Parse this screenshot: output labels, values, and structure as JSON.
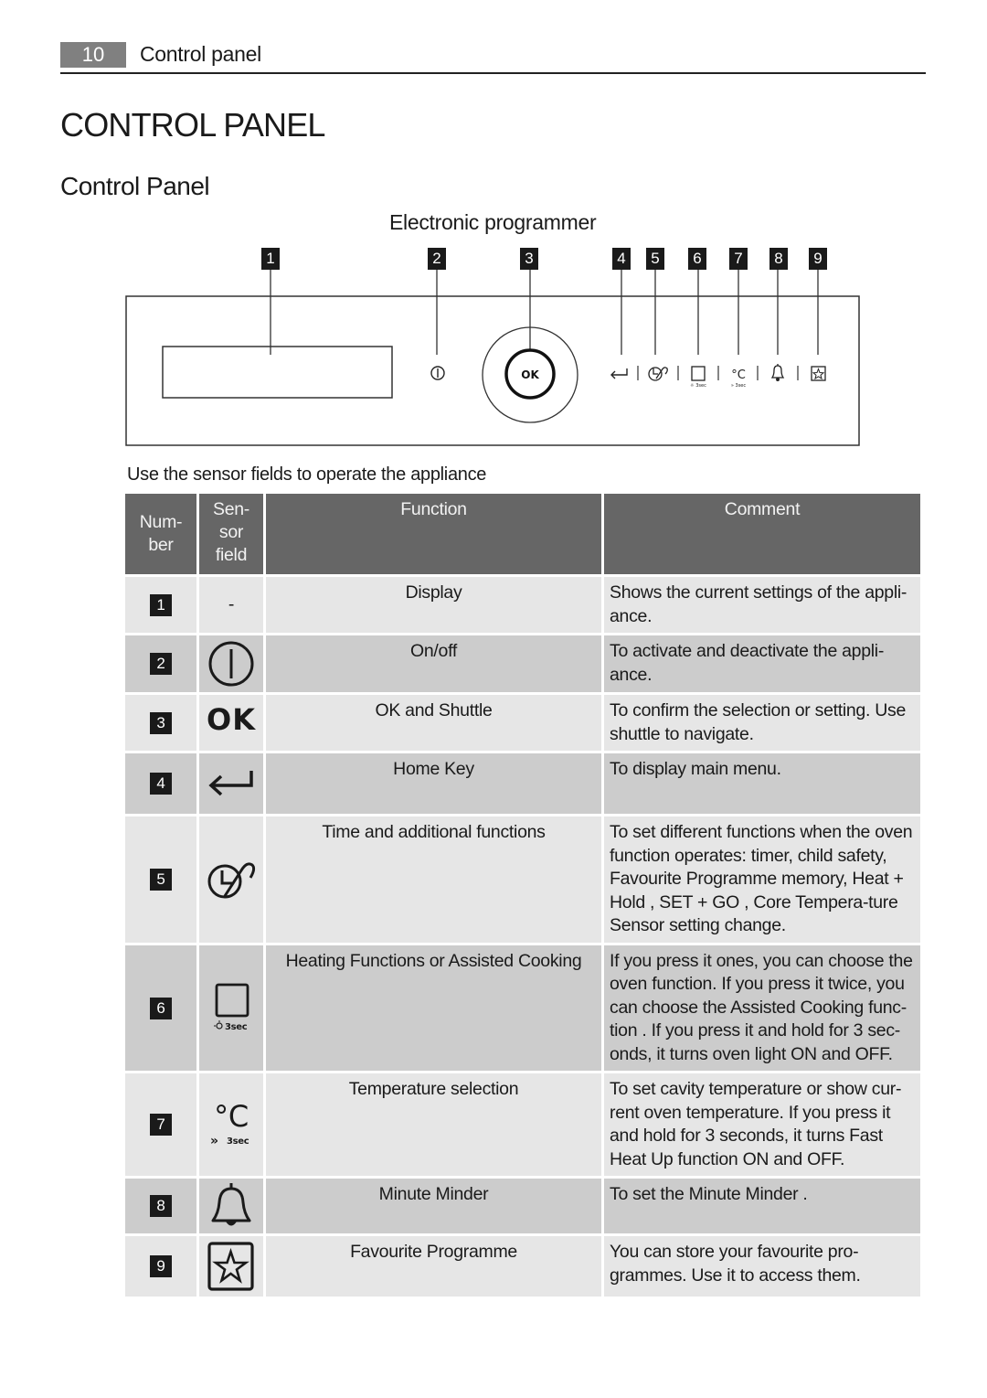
{
  "header": {
    "page_number": "10",
    "running_title": "Control panel"
  },
  "page_title": "CONTROL PANEL",
  "section_title": "Control Panel",
  "diagram": {
    "title": "Electronic programmer",
    "callouts": [
      "1",
      "2",
      "3",
      "4",
      "5",
      "6",
      "7",
      "8",
      "9"
    ],
    "ok_label": "OK",
    "hold_label": "3sec"
  },
  "caption": "Use the sensor fields to operate the appliance",
  "table": {
    "headers": {
      "number": "Num-\nber",
      "sensor": "Sen-\nsor\nfield",
      "function": "Function",
      "comment": "Comment"
    },
    "rows": [
      {
        "number": "1",
        "sensor": "-",
        "sensor_icon": "none",
        "function": "Display",
        "comment": "Shows the current settings of the appli-ance."
      },
      {
        "number": "2",
        "sensor_icon": "power-icon",
        "function": "On/off",
        "comment": "To activate and deactivate the appli-ance."
      },
      {
        "number": "3",
        "sensor": "OK",
        "sensor_icon": "ok-icon",
        "function": "OK and Shuttle",
        "comment": "To confirm the selection or setting. Use shuttle to navigate."
      },
      {
        "number": "4",
        "sensor_icon": "home-return-icon",
        "function": "Home Key",
        "comment": "To display main menu."
      },
      {
        "number": "5",
        "sensor_icon": "clock-functions-icon",
        "function": "Time and additional functions",
        "comment": "To set different functions when the oven function operates: timer, child safety, Favourite Programme memory, Heat + Hold , SET + GO , Core Tempera-ture Sensor setting change."
      },
      {
        "number": "6",
        "sensor_icon": "oven-function-light-icon",
        "sensor_sub": "3sec",
        "function": "Heating Functions or Assisted Cooking",
        "comment": "If you press it ones, you can choose the oven function. If you press it twice, you can choose the Assisted Cooking func-tion . If you press it and hold for 3 sec-onds, it turns oven light ON and OFF."
      },
      {
        "number": "7",
        "sensor": "°C",
        "sensor_icon": "temperature-icon",
        "sensor_sub": "3sec",
        "function": "Temperature selection",
        "comment": "To set cavity temperature or show cur-rent oven temperature. If you press it and hold for 3 seconds, it turns Fast Heat Up function ON and OFF."
      },
      {
        "number": "8",
        "sensor_icon": "bell-icon",
        "function": "Minute Minder",
        "comment": "To set the Minute Minder ."
      },
      {
        "number": "9",
        "sensor_icon": "star-icon",
        "function": "Favourite Programme",
        "comment": "You can store your favourite pro-grammes. Use it to access them."
      }
    ]
  }
}
